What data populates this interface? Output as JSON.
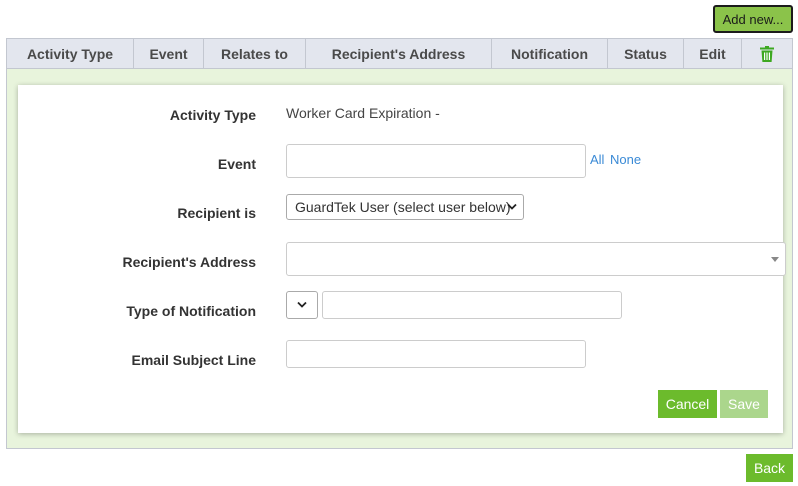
{
  "toolbar": {
    "add_new_label": "Add new..."
  },
  "table": {
    "columns": [
      "Activity Type",
      "Event",
      "Relates to",
      "Recipient's Address",
      "Notification",
      "Status",
      "Edit"
    ]
  },
  "form": {
    "activity_type_label": "Activity Type",
    "activity_type_value": "Worker Card Expiration -",
    "event_label": "Event",
    "event_value": "",
    "event_links": {
      "all": "All",
      "none": "None"
    },
    "recipient_is_label": "Recipient is",
    "recipient_is_value": "GuardTek User (select user below)",
    "recipient_address_label": "Recipient's Address",
    "recipient_address_value": "",
    "notification_type_label": "Type of Notification",
    "notification_type_value": "",
    "notification_detail_value": "",
    "email_subject_label": "Email Subject Line",
    "email_subject_value": "",
    "cancel_label": "Cancel",
    "save_label": "Save"
  },
  "footer": {
    "back_label": "Back"
  },
  "icons": {
    "delete": "trash-icon",
    "dropdown": "chevron-down-icon",
    "select_arrow": "caret-down-icon"
  },
  "colors": {
    "primary_green": "#6cbb2c",
    "disabled_green": "#abd68c",
    "add_new_green": "#8bc34a",
    "header_bg": "#e3e6ee",
    "panel_bg": "#e8f4dc",
    "link_blue": "#3a8ad6",
    "trash_green": "#3da821"
  }
}
